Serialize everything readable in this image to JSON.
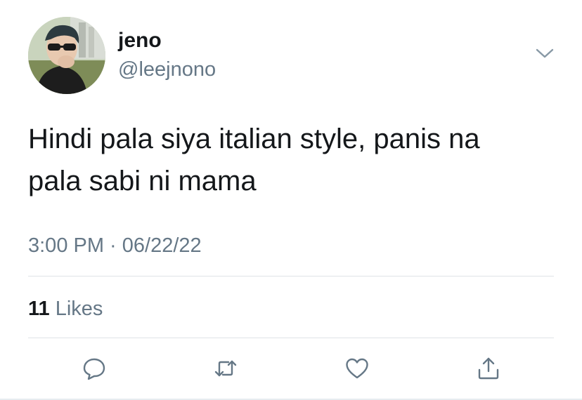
{
  "user": {
    "display_name": "jeno",
    "handle": "@leejnono"
  },
  "tweet": {
    "text": "Hindi pala siya italian style, panis na\npala sabi ni mama",
    "timestamp": "3:00 PM · 06/22/22"
  },
  "stats": {
    "likes_count": "11",
    "likes_label": "Likes"
  },
  "icons": {
    "more": "chevron-down-icon",
    "reply": "comment-icon",
    "retweet": "retweet-icon",
    "like": "heart-icon",
    "share": "share-icon"
  },
  "colors": {
    "text_primary": "#14171a",
    "text_secondary": "#657786",
    "icon_gray": "#657786",
    "divider": "#dfe3e6"
  }
}
